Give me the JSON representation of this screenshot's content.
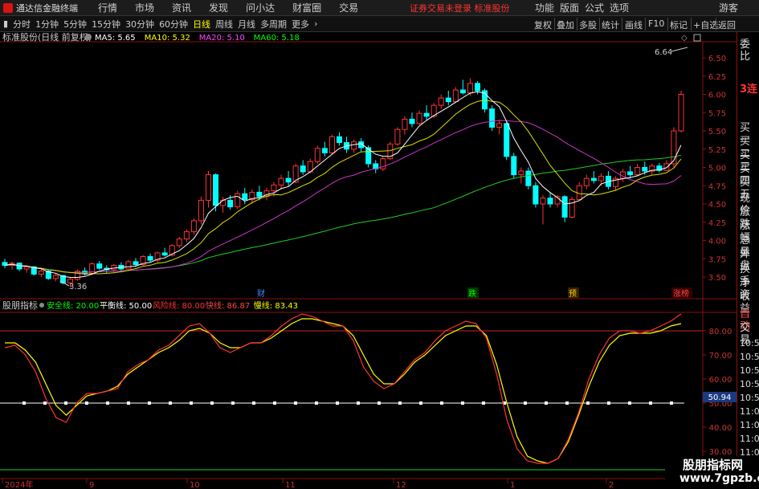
{
  "menubar": {
    "app_name": "通达信金融终端",
    "items": [
      "行情",
      "市场",
      "资讯",
      "发现",
      "问小达",
      "财富圈",
      "交易"
    ],
    "status": "证券交易未登录  标准股份",
    "right_items": [
      "功能",
      "版面",
      "公式",
      "选项",
      "游客"
    ]
  },
  "toolbar": {
    "periods": [
      "分时",
      "1分钟",
      "5分钟",
      "15分钟",
      "30分钟",
      "60分钟",
      "日线",
      "周线",
      "月线",
      "多周期",
      "更多"
    ],
    "active_period": "日线",
    "right_buttons": [
      "复权",
      "叠加",
      "多股",
      "统计",
      "画线",
      "F10",
      "标记",
      "+自选",
      "返回"
    ]
  },
  "main_chart": {
    "stock_title": "标准股份(日线 前复权)",
    "ma_labels": [
      {
        "text": "MA5: 5.65",
        "color": "#ffffff"
      },
      {
        "text": "MA10: 5.32",
        "color": "#ffff00"
      },
      {
        "text": "MA20: 5.10",
        "color": "#ff44ff"
      },
      {
        "text": "MA60: 5.18",
        "color": "#00ff00"
      }
    ],
    "y_ticks": [
      "6.50",
      "6.25",
      "6.00",
      "5.75",
      "5.50",
      "5.25",
      "5.00",
      "4.75",
      "4.50",
      "4.25",
      "4.00",
      "3.75",
      "3.50"
    ],
    "high_label": "6.64",
    "low_label": "3.36",
    "event_markers": [
      {
        "text": "财",
        "color": "#4488ff"
      },
      {
        "text": "跌",
        "color": "#00ff00"
      },
      {
        "text": "预",
        "color": "#ffcc00"
      },
      {
        "text": "涨榜",
        "color": "#ff4444"
      }
    ]
  },
  "indicator": {
    "name": "股朋指标",
    "labels": [
      {
        "text": "安全线: 20.00",
        "color": "#00ff00"
      },
      {
        "text": "平衡线: 50.00",
        "color": "#ffffff"
      },
      {
        "text": "风险线: 80.00",
        "color": "#ff3333"
      },
      {
        "text": "快线: 86.87",
        "color": "#ff4444"
      },
      {
        "text": "慢线: 83.43",
        "color": "#ffff00"
      }
    ],
    "y_ticks": [
      "80.00",
      "70.00",
      "60.00",
      "50.00",
      "40.00",
      "30.00"
    ],
    "current_value": "50.94"
  },
  "x_axis": [
    "2024年",
    "9",
    "10",
    "11",
    "12",
    "1",
    "2"
  ],
  "right_panel": {
    "header": "委比",
    "streak": "3连",
    "items": [
      "买一",
      "买二",
      "买三",
      "买四",
      "买五",
      "现价",
      "涨跌",
      "涨幅",
      "总量",
      "外盘",
      "换手",
      "净资",
      "收益"
    ],
    "mode": "自动",
    "trade_label": "交易",
    "times": [
      "10:5",
      "10:5",
      "10:5",
      "10:5",
      "10:5",
      "11:0",
      "11:0",
      "11:0",
      "11:0",
      "11:0",
      "11:0",
      "11:0"
    ]
  },
  "watermark": {
    "line1": "股朋指标网",
    "line2": "www.7gpzb.com"
  },
  "chart_data": {
    "type": "candlestick",
    "price": {
      "ylim": [
        3.3,
        6.6
      ],
      "ohlc": [
        [
          3.7,
          3.75,
          3.62,
          3.66
        ],
        [
          3.66,
          3.71,
          3.6,
          3.69
        ],
        [
          3.69,
          3.7,
          3.58,
          3.61
        ],
        [
          3.61,
          3.66,
          3.56,
          3.64
        ],
        [
          3.64,
          3.65,
          3.52,
          3.54
        ],
        [
          3.54,
          3.6,
          3.5,
          3.58
        ],
        [
          3.58,
          3.6,
          3.46,
          3.48
        ],
        [
          3.48,
          3.55,
          3.44,
          3.52
        ],
        [
          3.52,
          3.53,
          3.4,
          3.42
        ],
        [
          3.42,
          3.5,
          3.36,
          3.47
        ],
        [
          3.47,
          3.6,
          3.45,
          3.58
        ],
        [
          3.58,
          3.63,
          3.52,
          3.55
        ],
        [
          3.55,
          3.7,
          3.53,
          3.68
        ],
        [
          3.68,
          3.72,
          3.6,
          3.62
        ],
        [
          3.62,
          3.66,
          3.55,
          3.6
        ],
        [
          3.6,
          3.68,
          3.56,
          3.66
        ],
        [
          3.66,
          3.7,
          3.58,
          3.61
        ],
        [
          3.61,
          3.73,
          3.59,
          3.71
        ],
        [
          3.71,
          3.76,
          3.64,
          3.67
        ],
        [
          3.67,
          3.8,
          3.65,
          3.78
        ],
        [
          3.78,
          3.82,
          3.7,
          3.73
        ],
        [
          3.73,
          3.85,
          3.7,
          3.83
        ],
        [
          3.83,
          3.9,
          3.78,
          3.8
        ],
        [
          3.8,
          3.95,
          3.78,
          3.93
        ],
        [
          3.93,
          4.05,
          3.9,
          4.02
        ],
        [
          4.02,
          4.15,
          3.98,
          4.12
        ],
        [
          4.12,
          4.3,
          4.08,
          4.27
        ],
        [
          4.27,
          4.6,
          4.22,
          4.55
        ],
        [
          4.55,
          4.95,
          4.45,
          4.9
        ],
        [
          4.9,
          4.92,
          4.4,
          4.48
        ],
        [
          4.48,
          4.6,
          4.38,
          4.55
        ],
        [
          4.55,
          4.62,
          4.42,
          4.46
        ],
        [
          4.46,
          4.68,
          4.43,
          4.64
        ],
        [
          4.64,
          4.72,
          4.5,
          4.56
        ],
        [
          4.56,
          4.7,
          4.5,
          4.66
        ],
        [
          4.66,
          4.75,
          4.55,
          4.6
        ],
        [
          4.6,
          4.72,
          4.55,
          4.68
        ],
        [
          4.68,
          4.8,
          4.6,
          4.76
        ],
        [
          4.76,
          4.9,
          4.7,
          4.85
        ],
        [
          4.85,
          4.95,
          4.75,
          4.8
        ],
        [
          4.8,
          5.05,
          4.78,
          5.02
        ],
        [
          5.02,
          5.1,
          4.9,
          4.94
        ],
        [
          4.94,
          5.12,
          4.92,
          5.08
        ],
        [
          5.08,
          5.3,
          5.05,
          5.26
        ],
        [
          5.26,
          5.35,
          5.15,
          5.2
        ],
        [
          5.2,
          5.45,
          5.18,
          5.42
        ],
        [
          5.42,
          5.48,
          5.3,
          5.34
        ],
        [
          5.34,
          5.42,
          5.2,
          5.25
        ],
        [
          5.25,
          5.38,
          5.2,
          5.35
        ],
        [
          5.35,
          5.4,
          5.22,
          5.27
        ],
        [
          5.27,
          5.3,
          5.0,
          5.05
        ],
        [
          5.05,
          5.1,
          4.92,
          4.98
        ],
        [
          4.98,
          5.15,
          4.95,
          5.12
        ],
        [
          5.12,
          5.35,
          5.1,
          5.32
        ],
        [
          5.32,
          5.55,
          5.3,
          5.52
        ],
        [
          5.52,
          5.7,
          5.45,
          5.66
        ],
        [
          5.66,
          5.75,
          5.55,
          5.6
        ],
        [
          5.6,
          5.78,
          5.58,
          5.74
        ],
        [
          5.74,
          5.85,
          5.65,
          5.7
        ],
        [
          5.7,
          5.88,
          5.68,
          5.85
        ],
        [
          5.85,
          6.0,
          5.8,
          5.95
        ],
        [
          5.95,
          6.05,
          5.85,
          5.9
        ],
        [
          5.9,
          6.1,
          5.88,
          6.06
        ],
        [
          6.06,
          6.2,
          6.0,
          6.02
        ],
        [
          6.02,
          6.22,
          5.98,
          6.15
        ],
        [
          6.15,
          6.18,
          6.0,
          6.05
        ],
        [
          6.05,
          6.08,
          5.75,
          5.8
        ],
        [
          5.8,
          5.85,
          5.5,
          5.55
        ],
        [
          5.55,
          5.65,
          5.45,
          5.6
        ],
        [
          5.6,
          5.62,
          5.1,
          5.15
        ],
        [
          5.15,
          5.2,
          4.85,
          4.9
        ],
        [
          4.9,
          5.0,
          4.78,
          4.95
        ],
        [
          4.95,
          5.0,
          4.7,
          4.75
        ],
        [
          4.75,
          4.8,
          4.45,
          4.5
        ],
        [
          4.5,
          4.62,
          4.22,
          4.58
        ],
        [
          4.58,
          4.65,
          4.45,
          4.5
        ],
        [
          4.5,
          4.62,
          4.45,
          4.6
        ],
        [
          4.6,
          4.62,
          4.25,
          4.32
        ],
        [
          4.32,
          4.6,
          4.3,
          4.56
        ],
        [
          4.56,
          4.8,
          4.55,
          4.75
        ],
        [
          4.75,
          4.9,
          4.7,
          4.85
        ],
        [
          4.85,
          4.95,
          4.78,
          4.82
        ],
        [
          4.82,
          4.92,
          4.75,
          4.88
        ],
        [
          4.88,
          4.95,
          4.7,
          4.74
        ],
        [
          4.74,
          4.88,
          4.68,
          4.85
        ],
        [
          4.85,
          4.98,
          4.8,
          4.94
        ],
        [
          4.94,
          5.02,
          4.85,
          4.9
        ],
        [
          4.9,
          5.05,
          4.88,
          5.0
        ],
        [
          5.0,
          5.08,
          4.9,
          4.95
        ],
        [
          4.95,
          5.05,
          4.9,
          5.02
        ],
        [
          5.02,
          5.06,
          4.93,
          4.96
        ],
        [
          4.96,
          5.1,
          4.95,
          5.05
        ],
        [
          5.05,
          5.55,
          5.0,
          5.5
        ],
        [
          5.5,
          6.05,
          5.48,
          6.0
        ]
      ]
    },
    "indicator": {
      "ylim": [
        25,
        100
      ],
      "fast": [
        73,
        74,
        70,
        63,
        52,
        44,
        42,
        50,
        54,
        54,
        55,
        56,
        63,
        66,
        68,
        72,
        74,
        78,
        82,
        83,
        79,
        73,
        71,
        73,
        75,
        75,
        78,
        82,
        85,
        87,
        86,
        84,
        82,
        82,
        76,
        65,
        59,
        56,
        58,
        63,
        68,
        71,
        76,
        80,
        82,
        84,
        83,
        77,
        62,
        43,
        31,
        26,
        25,
        25,
        27,
        35,
        46,
        60,
        70,
        77,
        80,
        80,
        79,
        80,
        82,
        84,
        87
      ],
      "slow": [
        75,
        75,
        72,
        67,
        58,
        49,
        45,
        49,
        53,
        54,
        55,
        57,
        62,
        65,
        68,
        71,
        73,
        76,
        80,
        81,
        79,
        75,
        73,
        73,
        75,
        75,
        77,
        80,
        83,
        85,
        85,
        84,
        83,
        82,
        78,
        70,
        62,
        58,
        58,
        62,
        67,
        70,
        74,
        78,
        80,
        82,
        82,
        78,
        66,
        50,
        36,
        28,
        26,
        25,
        27,
        34,
        45,
        57,
        67,
        74,
        78,
        79,
        79,
        79,
        80,
        82,
        83
      ]
    }
  }
}
